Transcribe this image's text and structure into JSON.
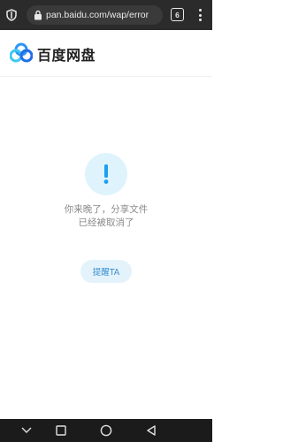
{
  "browser": {
    "url": "pan.baidu.com/wap/error",
    "tab_count": "6",
    "icons": [
      "shield-icon",
      "lock-icon",
      "tabs-icon",
      "more-vert-icon"
    ]
  },
  "app": {
    "brand_name": "百度网盘",
    "logo_icon": "baidu-netdisk-logo"
  },
  "message": {
    "icon": "exclamation-icon",
    "line1": "你来晚了，分享文件",
    "line2": "已经被取消了"
  },
  "actions": {
    "remind_label": "提醒TA"
  },
  "system_nav": {
    "icons": [
      "down-chevron-icon",
      "recents-square-icon",
      "home-circle-icon",
      "back-triangle-icon"
    ]
  },
  "colors": {
    "accent": "#3b8fd0",
    "accent_bg": "#e4f3fb",
    "icon_circle_bg": "#dff3fc",
    "icon_color": "#1aa0ef"
  }
}
